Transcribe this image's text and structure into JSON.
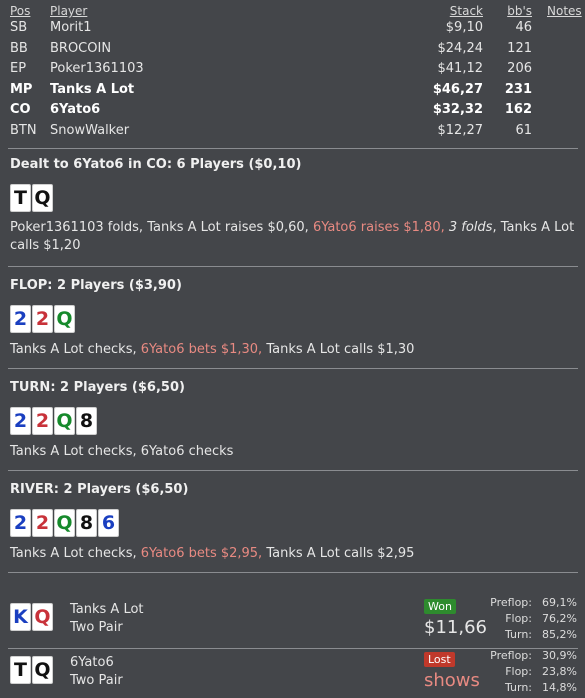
{
  "headers": {
    "pos": "Pos",
    "player": "Player",
    "stack": "Stack",
    "bbs": "bb's",
    "notes": "Notes"
  },
  "players": [
    {
      "pos": "SB",
      "name": "Morit1",
      "stack": "$9,10",
      "bbs": "46",
      "bold": false
    },
    {
      "pos": "BB",
      "name": "BROCOIN",
      "stack": "$24,24",
      "bbs": "121",
      "bold": false
    },
    {
      "pos": "EP",
      "name": "Poker1361103",
      "stack": "$41,12",
      "bbs": "206",
      "bold": false
    },
    {
      "pos": "MP",
      "name": "Tanks A Lot",
      "stack": "$46,27",
      "bbs": "231",
      "bold": true
    },
    {
      "pos": "CO",
      "name": "6Yato6",
      "stack": "$32,32",
      "bbs": "162",
      "bold": true
    },
    {
      "pos": "BTN",
      "name": "SnowWalker",
      "stack": "$12,27",
      "bbs": "61",
      "bold": false
    }
  ],
  "preflop": {
    "title": "Dealt to 6Yato6 in CO: 6 Players ($0,10)",
    "cards": [
      {
        "rank": "T",
        "suit": "s"
      },
      {
        "rank": "Q",
        "suit": "s"
      }
    ],
    "actions": {
      "a1": "Poker1361103 folds, Tanks A Lot raises $0,60, ",
      "a2": "6Yato6 raises $1,80, ",
      "a3": "3 folds",
      "a4": ", Tanks A Lot calls $1,20"
    }
  },
  "flop": {
    "title": "FLOP: 2 Players ($3,90)",
    "cards": [
      {
        "rank": "2",
        "suit": "d"
      },
      {
        "rank": "2",
        "suit": "h"
      },
      {
        "rank": "Q",
        "suit": "c"
      }
    ],
    "actions": {
      "a1": "Tanks A Lot checks, ",
      "a2": "6Yato6 bets $1,30, ",
      "a3": "Tanks A Lot calls $1,30"
    }
  },
  "turn": {
    "title": "TURN: 2 Players ($6,50)",
    "cards": [
      {
        "rank": "2",
        "suit": "d"
      },
      {
        "rank": "2",
        "suit": "h"
      },
      {
        "rank": "Q",
        "suit": "c"
      },
      {
        "rank": "8",
        "suit": "s"
      }
    ],
    "actions": {
      "a1": "Tanks A Lot checks, 6Yato6 checks"
    }
  },
  "river": {
    "title": "RIVER: 2 Players ($6,50)",
    "cards": [
      {
        "rank": "2",
        "suit": "d"
      },
      {
        "rank": "2",
        "suit": "h"
      },
      {
        "rank": "Q",
        "suit": "c"
      },
      {
        "rank": "8",
        "suit": "s"
      },
      {
        "rank": "6",
        "suit": "d"
      }
    ],
    "actions": {
      "a1": "Tanks A Lot checks, ",
      "a2": "6Yato6 bets $2,95, ",
      "a3": "Tanks A Lot calls $2,95"
    }
  },
  "showdown": [
    {
      "cards": [
        {
          "rank": "K",
          "suit": "d"
        },
        {
          "rank": "Q",
          "suit": "h"
        }
      ],
      "name": "Tanks A Lot",
      "hand": "Two Pair",
      "result": "Won",
      "amount": "$11,66",
      "stats": [
        {
          "label": "Preflop:",
          "val": "69,1%"
        },
        {
          "label": "Flop:",
          "val": "76,2%"
        },
        {
          "label": "Turn:",
          "val": "85,2%"
        }
      ]
    },
    {
      "cards": [
        {
          "rank": "T",
          "suit": "s"
        },
        {
          "rank": "Q",
          "suit": "s"
        }
      ],
      "name": "6Yato6",
      "hand": "Two Pair",
      "result": "Lost",
      "amount": "shows",
      "stats": [
        {
          "label": "Preflop:",
          "val": "30,9%"
        },
        {
          "label": "Flop:",
          "val": "23,8%"
        },
        {
          "label": "Turn:",
          "val": "14,8%"
        }
      ]
    }
  ],
  "colors": {
    "bg": "#44464a",
    "highlight": "#e88a82",
    "won": "#2e8b2e",
    "lost": "#c0392b",
    "spade": "#111111",
    "heart": "#c8323a",
    "diamond": "#1a3fc0",
    "club": "#168a2c"
  }
}
